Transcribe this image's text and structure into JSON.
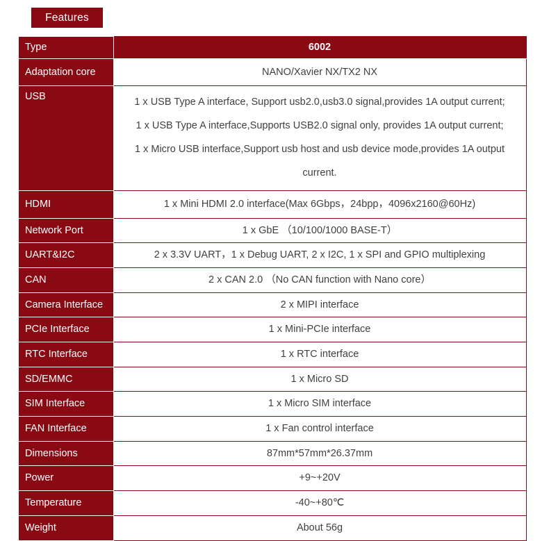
{
  "banner": {
    "label": "Features"
  },
  "colors": {
    "brand_red": "#8a0a14",
    "value_text": "#404040",
    "page_background": "#ffffff"
  },
  "table": {
    "header": {
      "label": "Type",
      "value": "6002"
    },
    "rows": [
      {
        "label": "Adaptation core",
        "value": "NANO/Xavier NX/TX2 NX"
      },
      {
        "label": "USB",
        "lines": [
          "1 x USB Type A interface, Support usb2.0,usb3.0 signal,provides 1A output current;",
          "1 x USB Type A  interface,Supports USB2.0 signal only, provides 1A output current;",
          "1 x Micro USB  interface,Support usb host and usb device mode,provides 1A output",
          "current."
        ]
      },
      {
        "label": "HDMI",
        "value": "1 x Mini HDMI 2.0 interface(Max 6Gbps，24bpp，4096x2160@60Hz)"
      },
      {
        "label": "Network Port",
        "value": "1 x GbE （10/100/1000 BASE-T）"
      },
      {
        "label": "UART&I2C",
        "value": "2 x 3.3V UART，1 x Debug UART, 2 x I2C, 1 x SPI and GPIO multiplexing"
      },
      {
        "label": "CAN",
        "value": "2 x CAN 2.0 （No CAN function with Nano core）"
      },
      {
        "label": "Camera Interface",
        "value": "2 x MIPI interface"
      },
      {
        "label": "PCIe Interface",
        "value": "1 x Mini-PCIe interface"
      },
      {
        "label": "RTC Interface",
        "value": "1 x RTC interface"
      },
      {
        "label": "SD/EMMC",
        "value": "1 x Micro SD"
      },
      {
        "label": "SIM Interface",
        "value": "1 x Micro SIM interface"
      },
      {
        "label": "FAN Interface",
        "value": "1 x Fan control interface"
      },
      {
        "label": "Dimensions",
        "value": "87mm*57mm*26.37mm"
      },
      {
        "label": "Power",
        "value": "+9~+20V"
      },
      {
        "label": "Temperature",
        "value": "-40~+80℃"
      },
      {
        "label": "Weight",
        "value": "About 56g"
      }
    ]
  }
}
